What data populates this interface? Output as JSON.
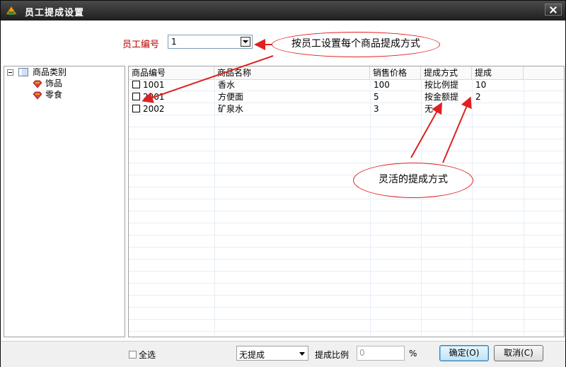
{
  "window": {
    "title": "员工提成设置"
  },
  "employee": {
    "label": "员工编号",
    "value": "1"
  },
  "tree": {
    "root": "商品类别",
    "children": [
      "饰品",
      "零食"
    ]
  },
  "table": {
    "columns": [
      "商品编号",
      "商品名称",
      "销售价格",
      "提成方式",
      "提成"
    ],
    "rows": [
      {
        "code": "1001",
        "name": "香水",
        "price": "100",
        "method": "按比例提",
        "commission": "10"
      },
      {
        "code": "2001",
        "name": "方便面",
        "price": "5",
        "method": "按金额提",
        "commission": "2"
      },
      {
        "code": "2002",
        "name": "矿泉水",
        "price": "3",
        "method": "无",
        "commission": ""
      }
    ]
  },
  "annotations": {
    "top": "按员工设置每个商品提成方式",
    "bottom": "灵活的提成方式"
  },
  "footer": {
    "select_all": "全选",
    "mode": "无提成",
    "ratio_label": "提成比例",
    "ratio_value": "0",
    "percent": "%",
    "ok": "确定(O)",
    "cancel": "取消(C)"
  },
  "colors": {
    "accent_red": "#e02020",
    "title_bar": "#2b2b2b"
  }
}
